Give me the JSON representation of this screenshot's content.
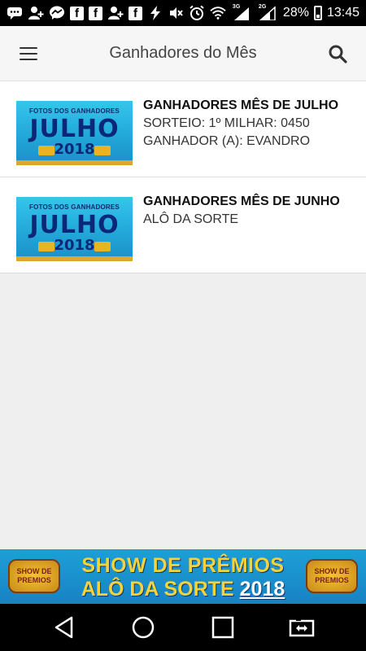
{
  "status_bar": {
    "battery_percent": "28%",
    "time": "13:45",
    "signal_badge_1": "3G",
    "signal_badge_2": "2G"
  },
  "app_bar": {
    "title": "Ganhadores do Mês"
  },
  "list": {
    "items": [
      {
        "title": "GANHADORES MÊS DE JULHO",
        "lines": [
          "SORTEIO: 1º MILHAR: 0450",
          "GANHADOR (A): EVANDRO"
        ],
        "thumb": {
          "top": "FOTOS DOS GANHADORES",
          "main": "JULHO",
          "year": "2018"
        }
      },
      {
        "title": "GANHADORES MÊS DE JUNHO",
        "lines": [
          "ALÔ DA SORTE"
        ],
        "thumb": {
          "top": "FOTOS DOS GANHADORES",
          "main": "JULHO",
          "year": "2018"
        }
      }
    ]
  },
  "banner": {
    "line1": "SHOW DE PRÊMIOS",
    "line2_prefix": "ALÔ DA SORTE",
    "line2_year": "2018",
    "logo_text": "SHOW DE PREMIOS"
  },
  "colors": {
    "banner_text": "#f6d23a",
    "thumb_text": "#0b2878",
    "thumb_bg": "#22a7d9"
  },
  "icons": [
    "menu-icon",
    "search-icon",
    "back-icon",
    "home-icon",
    "recents-icon",
    "screen-rotate-icon"
  ]
}
